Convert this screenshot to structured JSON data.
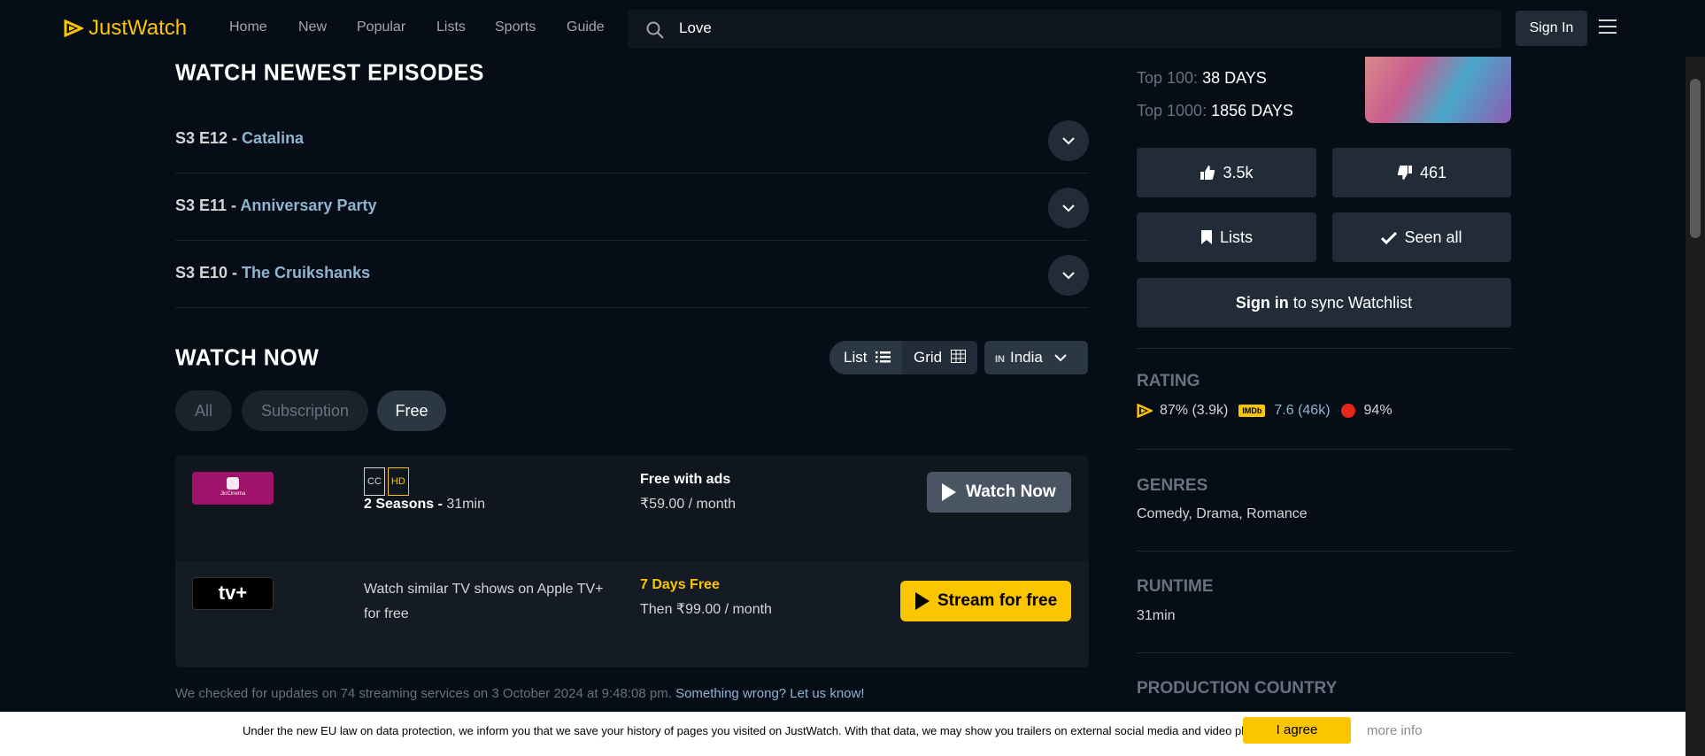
{
  "nav": {
    "logo": "JustWatch",
    "links": [
      "Home",
      "New",
      "Popular",
      "Lists",
      "Sports",
      "Guide"
    ],
    "search_value": "Love",
    "signin": "Sign In"
  },
  "episodes": {
    "title": "WATCH NEWEST EPISODES",
    "items": [
      {
        "code": "S3 E12 - ",
        "name": "Catalina"
      },
      {
        "code": "S3 E11 - ",
        "name": "Anniversary Party"
      },
      {
        "code": "S3 E10 - ",
        "name": "The Cruikshanks"
      }
    ]
  },
  "watch_now": {
    "title": "WATCH NOW",
    "view_list": "List",
    "view_grid": "Grid",
    "country_code": "IN",
    "country": "India",
    "filters": [
      "All",
      "Subscription",
      "Free"
    ],
    "active_filter": "Free",
    "offers": [
      {
        "provider_icon": "jiocinema-logo",
        "provider_label": "JioCinema",
        "badges": [
          "CC",
          "HD"
        ],
        "seasons": "2 Seasons -",
        "runtime": " 31min",
        "price_title": "Free with ads",
        "price": "₹59.00 / month",
        "button": "Watch Now"
      },
      {
        "provider_icon": "apple-tv-plus-logo",
        "provider_label": "tv+",
        "desc_line1": "Watch similar TV shows on Apple TV+",
        "desc_line2": "for free",
        "price_title": "7 Days Free",
        "price": "Then ₹99.00 / month",
        "button": "Stream for free"
      }
    ],
    "checked_text": "We checked for updates on 74 streaming services on 3 October 2024 at 9:48:08 pm.",
    "checked_link": "Something wrong? Let us know!"
  },
  "sidebar": {
    "top100_label": "Top 100:",
    "top100_value": "38 DAYS",
    "top1000_label": "Top 1000:",
    "top1000_value": "1856 DAYS",
    "likes": "3.5k",
    "dislikes": "461",
    "lists": "Lists",
    "seen_all": "Seen all",
    "signin_bold": "Sign in",
    "signin_rest": " to sync Watchlist",
    "rating_title": "RATING",
    "jw_rating": "87% (3.9k)",
    "imdb_label": "IMDb",
    "imdb_rating": "7.6 (46k)",
    "tomato_rating": "94%",
    "genres_title": "GENRES",
    "genres": "Comedy, Drama, Romance",
    "runtime_title": "RUNTIME",
    "runtime": "31min",
    "production_title": "PRODUCTION COUNTRY"
  },
  "cookie": {
    "text": "Under the new EU law on data protection, we inform you that we save your history of pages you visited on JustWatch. With that data, we may show you trailers on external social media and video platforms.",
    "agree": "I agree",
    "more": "more info"
  },
  "colors": {
    "background": "#060d17",
    "accent": "#fbc500",
    "link": "#8fb4cf"
  }
}
